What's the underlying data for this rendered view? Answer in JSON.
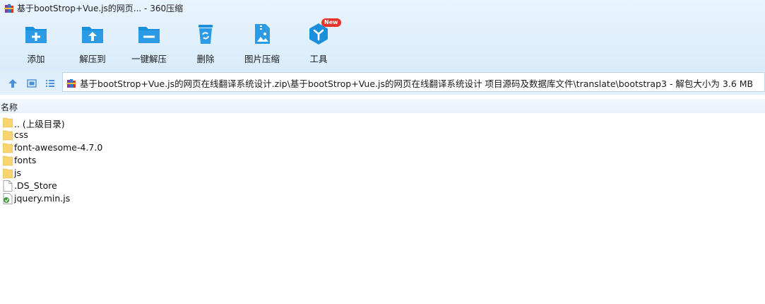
{
  "window": {
    "title": "基于bootStrop+Vue.js的网页... - 360压缩",
    "app_icon": "winrar-books-icon"
  },
  "toolbar": {
    "buttons": [
      {
        "label": "添加",
        "icon": "add-folder-icon"
      },
      {
        "label": "解压到",
        "icon": "extract-to-folder-icon"
      },
      {
        "label": "一键解压",
        "icon": "one-click-extract-icon"
      },
      {
        "label": "删除",
        "icon": "recycle-bin-icon"
      },
      {
        "label": "图片压缩",
        "icon": "image-compress-icon"
      },
      {
        "label": "工具",
        "icon": "tools-cube-icon",
        "badge": "New"
      }
    ]
  },
  "nav": {
    "icons": [
      "up-arrow-icon",
      "thumbnail-view-icon",
      "list-view-icon"
    ],
    "address": "基于bootStrop+Vue.js的网页在线翻译系统设计.zip\\基于bootStrop+Vue.js的网页在线翻译系统设计 项目源码及数据库文件\\translate\\bootstrap3 - 解包大小为 3.6 MB"
  },
  "columns": {
    "name": "名称"
  },
  "files": [
    {
      "name": ".. (上级目录)",
      "type": "folder"
    },
    {
      "name": "css",
      "type": "folder"
    },
    {
      "name": "font-awesome-4.7.0",
      "type": "folder"
    },
    {
      "name": "fonts",
      "type": "folder"
    },
    {
      "name": "js",
      "type": "folder"
    },
    {
      "name": ".DS_Store",
      "type": "file"
    },
    {
      "name": "jquery.min.js",
      "type": "js"
    }
  ],
  "colors": {
    "toolbar_bg": "#dfeefb",
    "icon_blue": "#1a8fdb",
    "badge_red": "#e8332a"
  }
}
